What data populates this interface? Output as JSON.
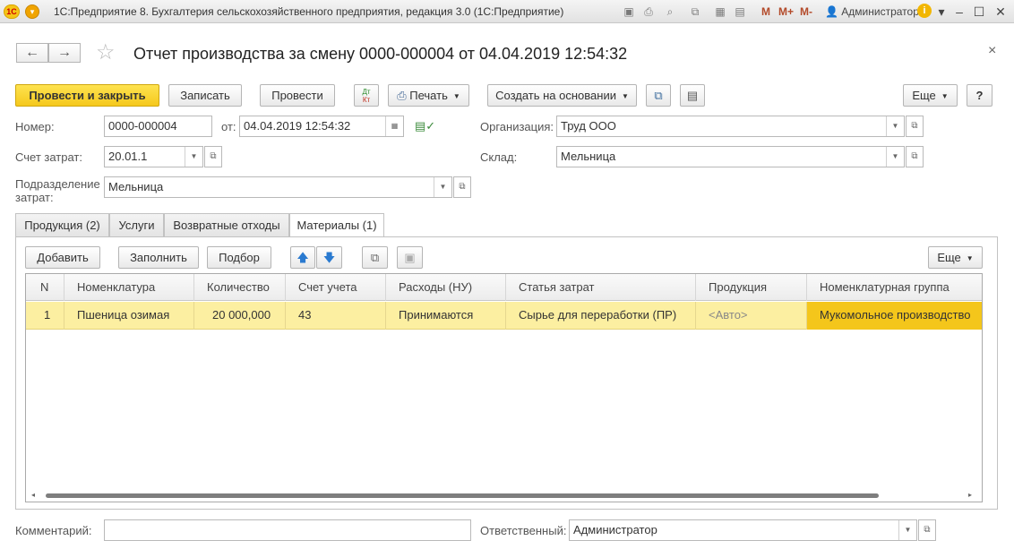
{
  "titlebar": {
    "logo": "1С",
    "title": "1С:Предприятие 8. Бухгалтерия сельскохозяйственного предприятия, редакция 3.0  (1С:Предприятие)",
    "m_buttons": [
      "M",
      "M+",
      "M-"
    ],
    "user": "Администратор"
  },
  "document": {
    "title": "Отчет производства за смену 0000-000004 от 04.04.2019 12:54:32"
  },
  "toolbar": {
    "post_close": "Провести и закрыть",
    "save": "Записать",
    "post": "Провести",
    "dtkt_top": "Дт",
    "dtkt_bottom": "Кт",
    "print": "Печать",
    "create_based": "Создать на основании",
    "more": "Еще",
    "help": "?"
  },
  "form": {
    "number_label": "Номер:",
    "number_value": "0000-000004",
    "date_label": "от:",
    "date_value": "04.04.2019 12:54:32",
    "org_label": "Организация:",
    "org_value": "Труд ООО",
    "account_label": "Счет затрат:",
    "account_value": "20.01.1",
    "warehouse_label": "Склад:",
    "warehouse_value": "Мельница",
    "division_label_1": "Подразделение",
    "division_label_2": "затрат:",
    "division_value": "Мельница"
  },
  "tabs": [
    {
      "label": "Продукция (2)"
    },
    {
      "label": "Услуги"
    },
    {
      "label": "Возвратные отходы"
    },
    {
      "label": "Материалы (1)"
    }
  ],
  "table_toolbar": {
    "add": "Добавить",
    "fill": "Заполнить",
    "pick": "Подбор",
    "more": "Еще"
  },
  "table": {
    "columns": [
      "N",
      "Номенклатура",
      "Количество",
      "Счет учета",
      "Расходы (НУ)",
      "Статья затрат",
      "Продукция",
      "Номенклатурная группа"
    ],
    "rows": [
      {
        "n": "1",
        "item": "Пшеница озимая",
        "qty": "20 000,000",
        "account": "43",
        "expenses": "Принимаются",
        "cost_item": "Сырье для переработки (ПР)",
        "product": "<Авто>",
        "group": "Мукомольное производство"
      }
    ]
  },
  "footer": {
    "comment_label": "Комментарий:",
    "comment_value": "",
    "responsible_label": "Ответственный:",
    "responsible_value": "Администратор"
  }
}
